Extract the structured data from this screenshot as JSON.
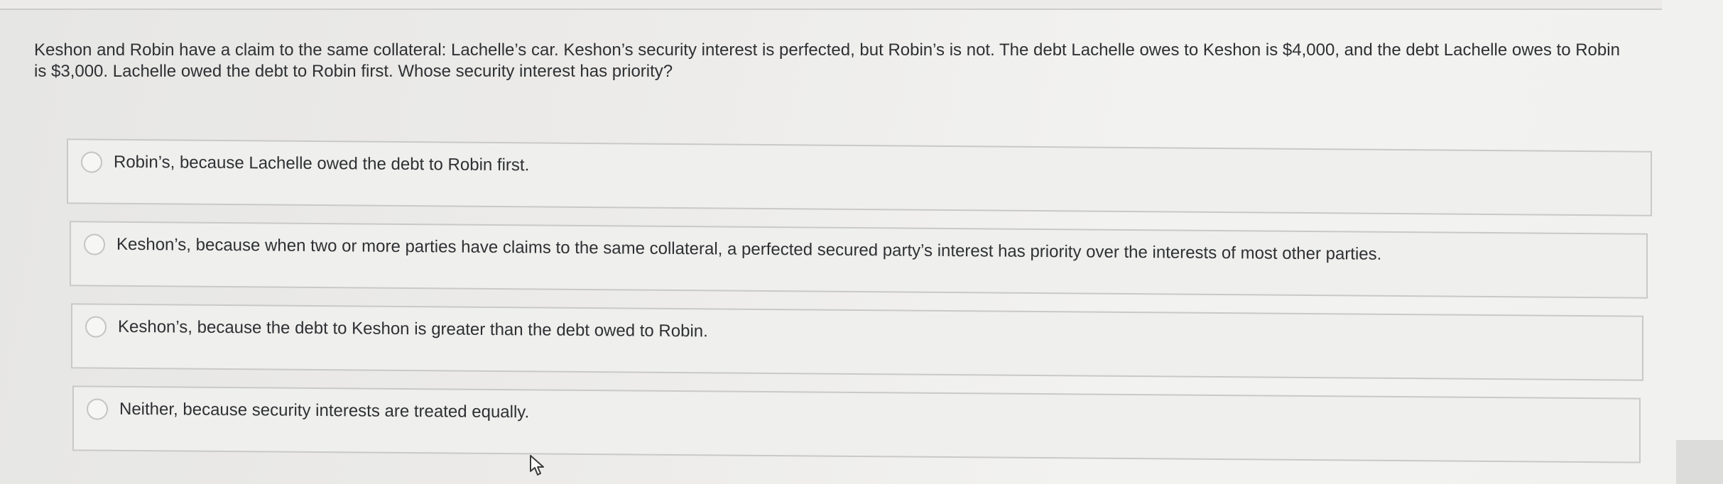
{
  "question": {
    "text": "Keshon and Robin have a claim to the same collateral: Lachelle’s car. Keshon’s security interest is perfected, but Robin’s is not. The debt Lachelle owes to Keshon is $4,000, and the debt Lachelle owes to Robin is $3,000. Lachelle owed the debt to Robin first. Whose security interest has priority?"
  },
  "options": [
    {
      "label": "Robin’s, because Lachelle owed the debt to Robin first.",
      "selected": false
    },
    {
      "label": "Keshon’s, because when two or more parties have claims to the same collateral, a perfected secured party’s interest has priority over the interests of most other parties.",
      "selected": false
    },
    {
      "label": "Keshon’s, because the debt to Keshon is greater than the debt owed to Robin.",
      "selected": false
    },
    {
      "label": "Neither, because security interests are treated equally.",
      "selected": false
    }
  ],
  "cursor": {
    "icon": "mouse-pointer-icon"
  }
}
